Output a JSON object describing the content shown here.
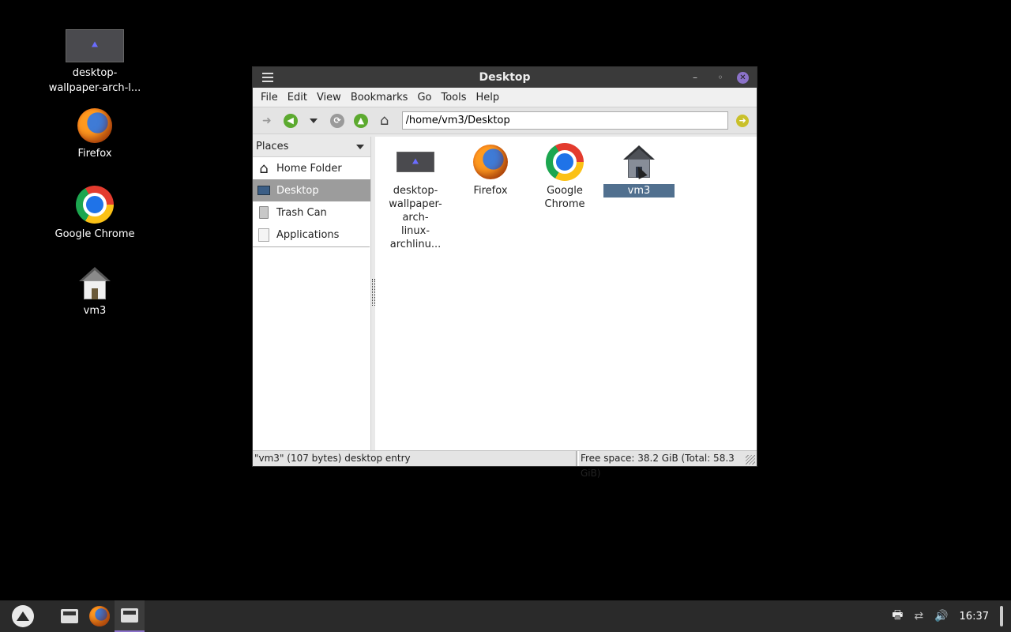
{
  "desktop": {
    "icons": [
      {
        "label": "desktop-wallpaper-arch-l...",
        "icon": "image-thumbnail-icon"
      },
      {
        "label": "Firefox",
        "icon": "firefox-icon"
      },
      {
        "label": "Google Chrome",
        "icon": "chrome-icon"
      },
      {
        "label": "vm3",
        "icon": "home-icon"
      }
    ]
  },
  "window": {
    "title": "Desktop",
    "menu": [
      "File",
      "Edit",
      "View",
      "Bookmarks",
      "Go",
      "Tools",
      "Help"
    ],
    "address": "/home/vm3/Desktop",
    "places": {
      "header": "Places",
      "items": [
        {
          "label": "Home Folder",
          "icon": "home-icon"
        },
        {
          "label": "Desktop",
          "icon": "desktop-icon",
          "selected": true
        },
        {
          "label": "Trash Can",
          "icon": "trash-icon"
        },
        {
          "label": "Applications",
          "icon": "applications-icon"
        }
      ]
    },
    "files": [
      {
        "label": "desktop-wallpaper-arch-linux-archlinu...",
        "line1": "desktop-",
        "line2": "wallpaper-arch-",
        "line3": "linux-archlinu..."
      },
      {
        "label": "Firefox"
      },
      {
        "label": "Google Chrome"
      },
      {
        "label": "vm3",
        "selected": true
      }
    ],
    "status_left": "\"vm3\" (107 bytes) desktop entry",
    "status_right": "Free space: 38.2 GiB (Total: 58.3 GiB)"
  },
  "taskbar": {
    "clock": "16:37",
    "accent": "#8b72c9"
  }
}
